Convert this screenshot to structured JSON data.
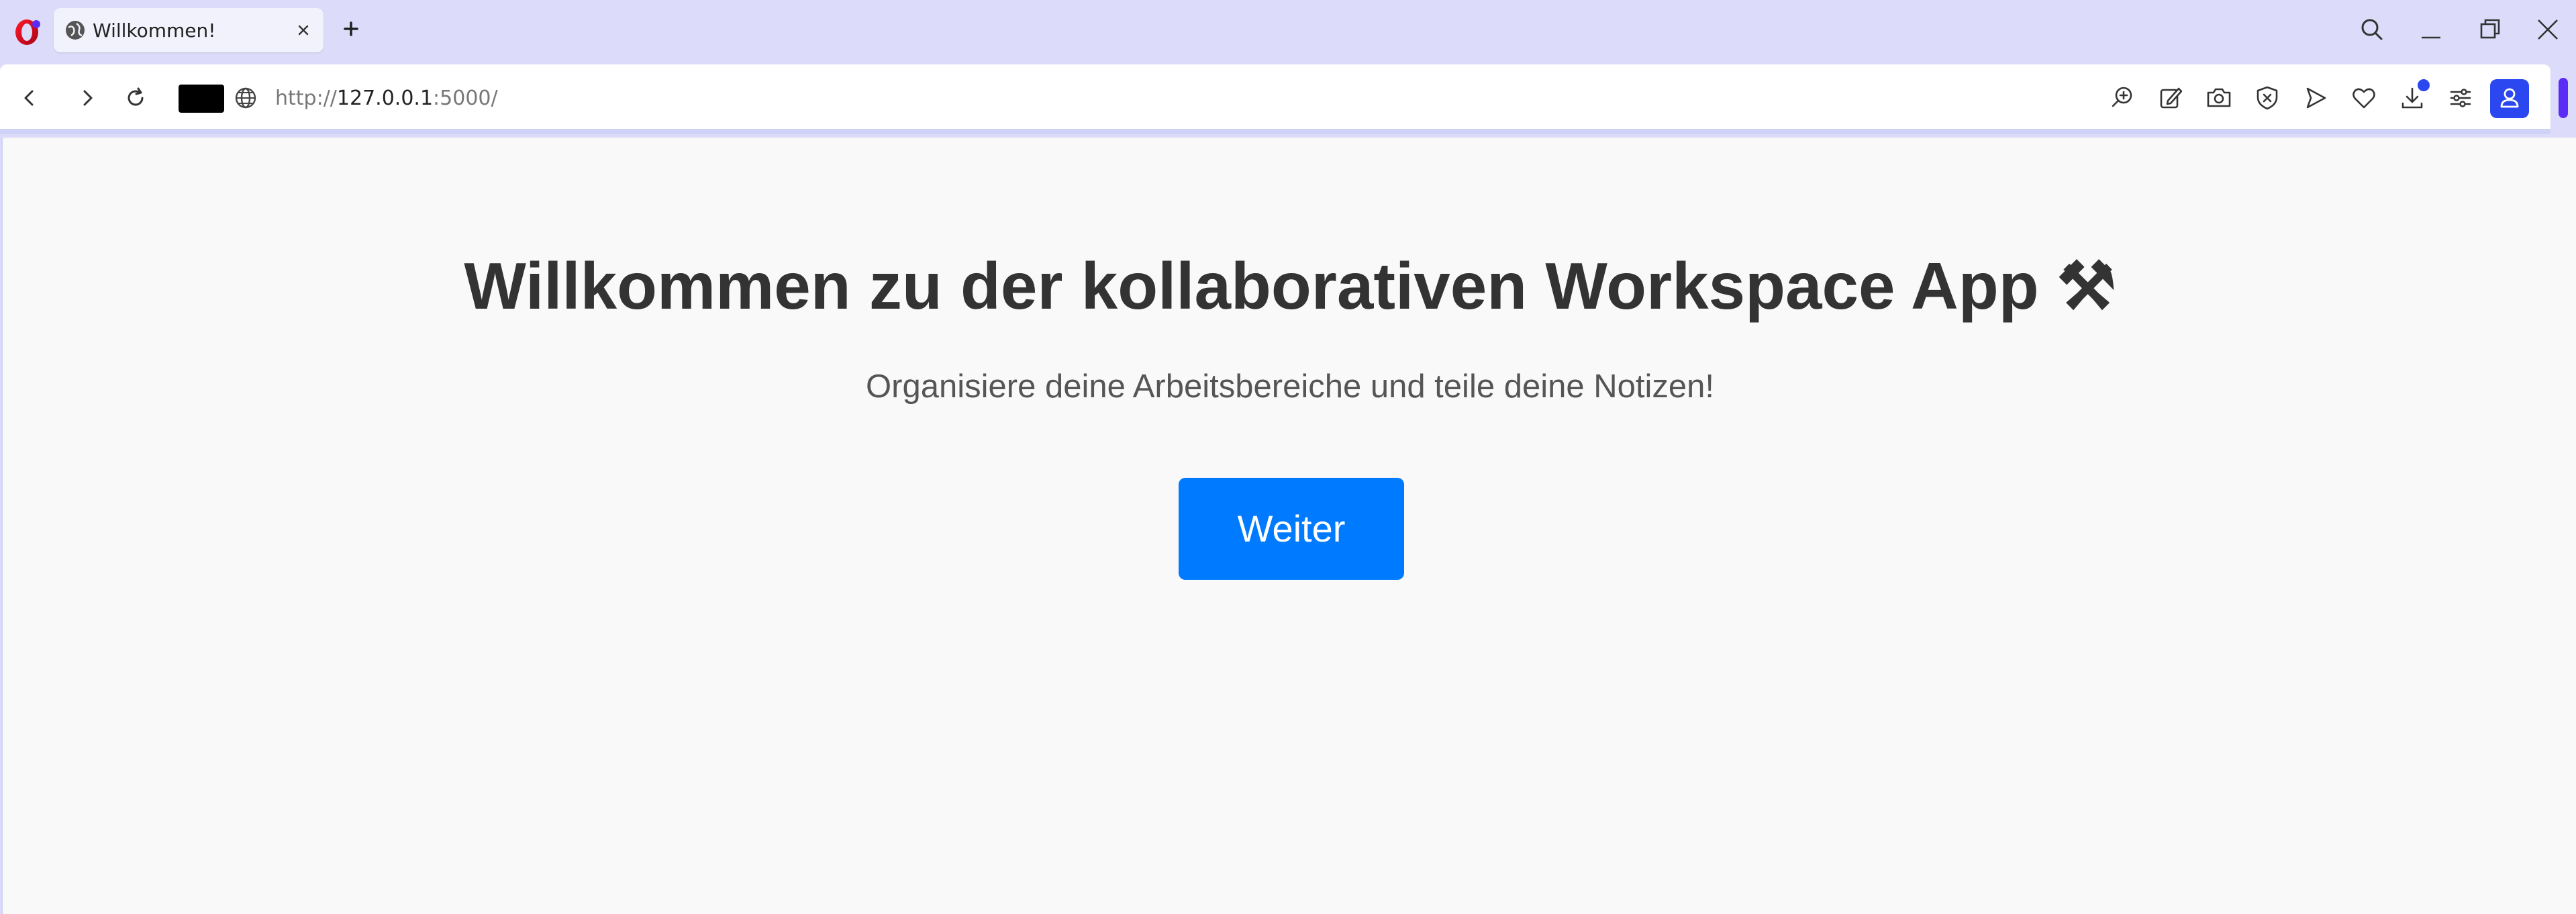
{
  "browser": {
    "tab": {
      "title": "Willkommen!",
      "favicon": "globe-icon",
      "close_icon": "close-icon"
    },
    "new_tab_icon": "plus-icon",
    "window_controls": [
      "search-icon",
      "minimize-icon",
      "restore-icon",
      "close-icon"
    ],
    "address_bar": {
      "scheme": "http://",
      "host": "127.0.0.1",
      "rest": ":5000/"
    },
    "toolbar_icons": [
      "zoom-in-icon",
      "edit-icon",
      "camera-icon",
      "shield-icon",
      "send-icon",
      "heart-icon",
      "download-icon",
      "settings-icon",
      "profile-icon"
    ],
    "accent_color": "#2b47f0"
  },
  "page": {
    "title": "Willkommen zu der kollaborativen Workspace App ⚒",
    "subtitle": "Organisiere deine Arbeitsbereiche und teile deine Notizen!",
    "button_label": "Weiter",
    "button_color": "#007bff"
  }
}
